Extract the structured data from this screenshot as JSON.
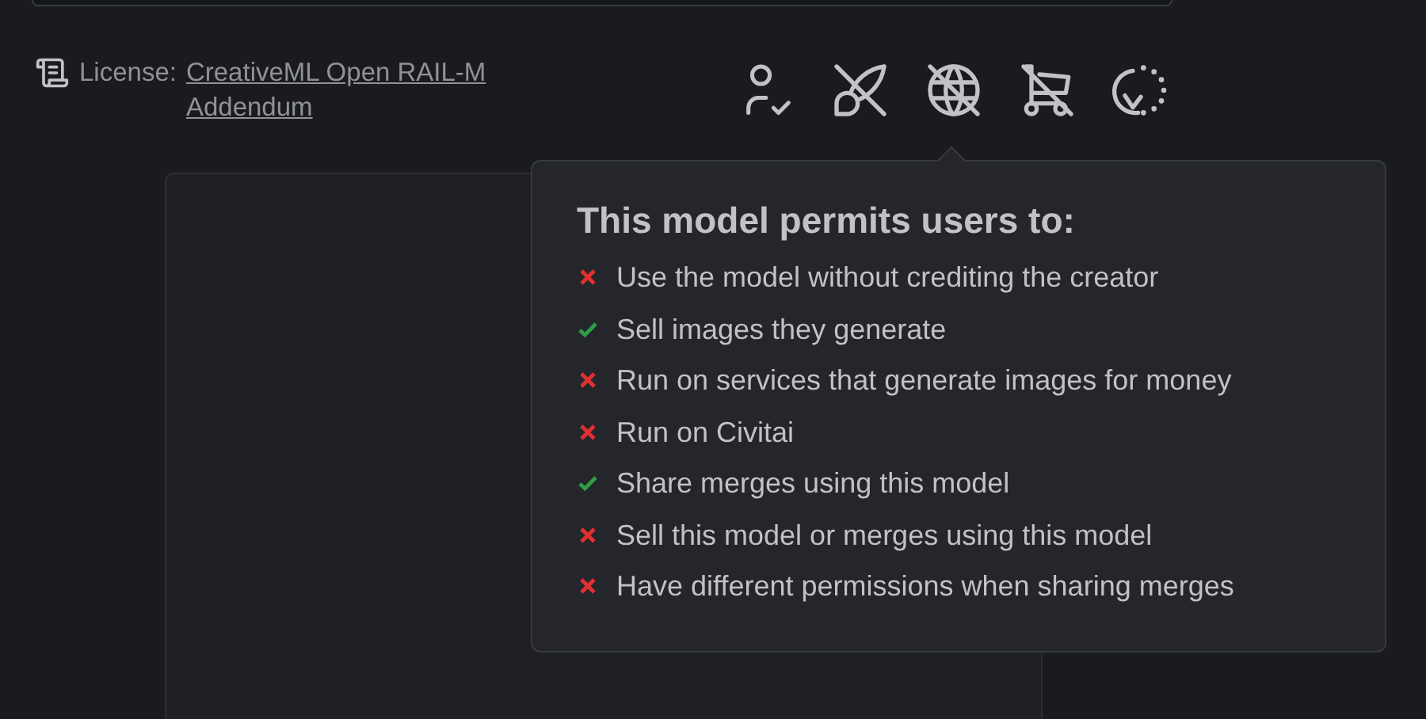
{
  "license": {
    "label": "License:",
    "link": "CreativeML Open RAIL-M Addendum"
  },
  "permissions_tooltip": {
    "title": "This model permits users to:",
    "items": [
      {
        "text": "Use the model without crediting the creator",
        "permitted": false
      },
      {
        "text": "Sell images they generate",
        "permitted": true
      },
      {
        "text": "Run on services that generate images for money",
        "permitted": false
      },
      {
        "text": "Run on Civitai",
        "permitted": false
      },
      {
        "text": "Share merges using this model",
        "permitted": true
      },
      {
        "text": "Sell this model or merges using this model",
        "permitted": false
      },
      {
        "text": "Have different permissions when sharing merges",
        "permitted": false
      }
    ]
  }
}
